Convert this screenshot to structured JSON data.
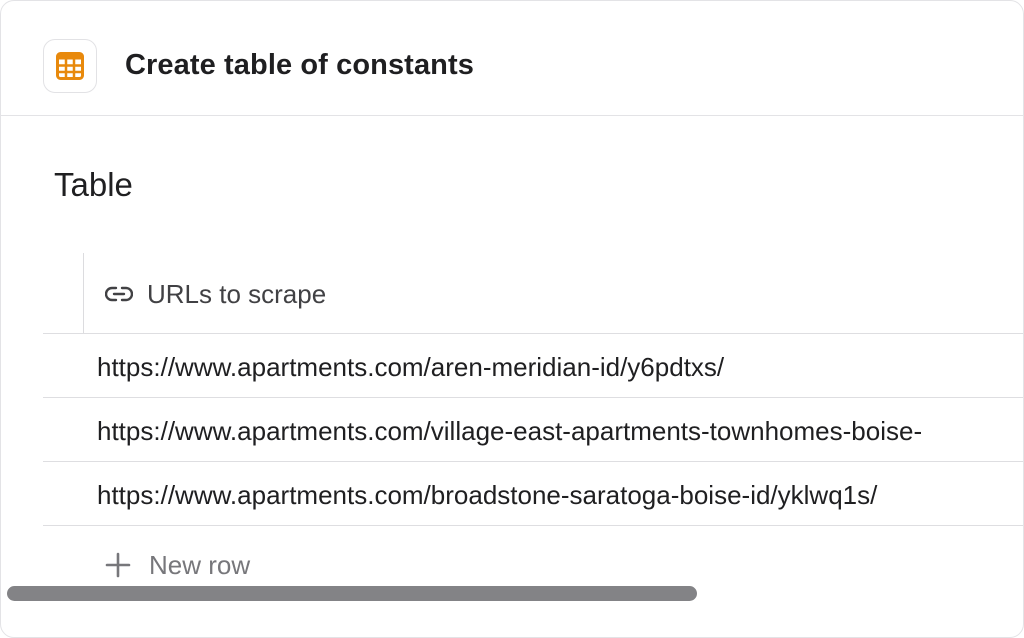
{
  "header": {
    "title": "Create table of constants",
    "icon": "table-icon",
    "icon_color": "#E8890C"
  },
  "section": {
    "title": "Table"
  },
  "table": {
    "column": {
      "icon": "link-icon",
      "label": "URLs to scrape"
    },
    "rows": [
      "https://www.apartments.com/aren-meridian-id/y6pdtxs/",
      "https://www.apartments.com/village-east-apartments-townhomes-boise-",
      "https://www.apartments.com/broadstone-saratoga-boise-id/yklwq1s/"
    ],
    "new_row_label": "New row",
    "new_row_icon": "plus-icon"
  }
}
